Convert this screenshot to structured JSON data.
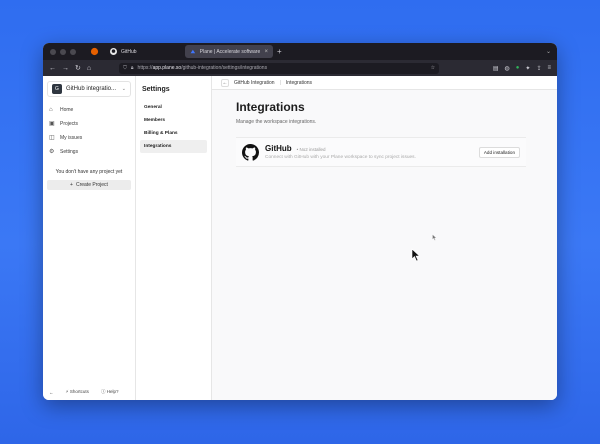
{
  "browser": {
    "tabs": [
      {
        "label": "GitHub",
        "icon": "github-icon"
      },
      {
        "label": "Plane | Accelerate software deli...",
        "icon": "plane-icon",
        "active": true
      }
    ],
    "url_host": "app.plane.so",
    "url_path": "/github-integration/settings/integrations",
    "url_scheme": "https://"
  },
  "sidebar": {
    "workspace_initial": "G",
    "workspace_name": "GitHub integratio...",
    "items": [
      {
        "label": "Home",
        "icon": "home-icon"
      },
      {
        "label": "Projects",
        "icon": "projects-icon"
      },
      {
        "label": "My issues",
        "icon": "issues-icon"
      },
      {
        "label": "Settings",
        "icon": "settings-icon"
      }
    ],
    "empty_text": "You don't have any project yet",
    "create_project": "Create Project",
    "footer": {
      "shortcuts": "Shortcuts",
      "help": "Help?"
    }
  },
  "settings": {
    "title": "Settings",
    "items": [
      "General",
      "Members",
      "Billing & Plans",
      "Integrations"
    ],
    "active_index": 3
  },
  "topbar": {
    "crumb1": "GitHub Integration",
    "crumb2": "Integrations"
  },
  "main": {
    "title": "Integrations",
    "subtitle": "Manage the workspace integrations.",
    "integration": {
      "name": "GitHub",
      "installs": "• No2 installed",
      "description": "Connect with GitHub with your Plane workspace to sync project issues.",
      "button": "Add installation"
    }
  },
  "colors": {
    "background": "#2f6df0",
    "accent": "#222222"
  }
}
